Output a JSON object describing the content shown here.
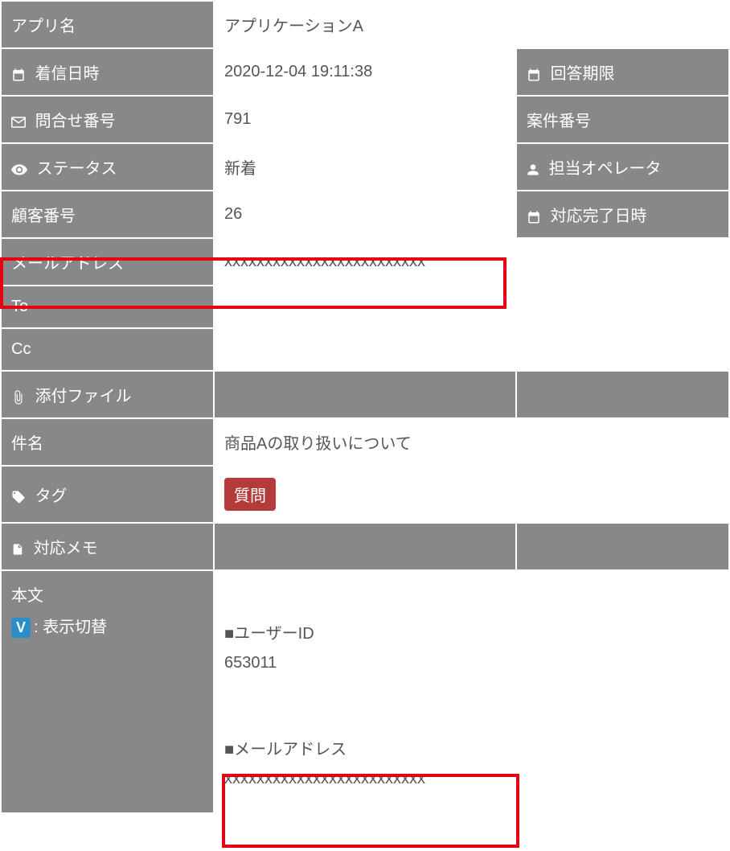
{
  "rows": {
    "app_name": {
      "label": "アプリ名",
      "value": "アプリケーションA"
    },
    "received": {
      "label": "着信日時",
      "value": "2020-12-04 19:11:38",
      "right_label": "回答期限"
    },
    "inquiry_no": {
      "label": "問合せ番号",
      "value": "791",
      "right_label": "案件番号"
    },
    "status": {
      "label": "ステータス",
      "value": "新着",
      "right_label": "担当オペレータ"
    },
    "customer_no": {
      "label": "顧客番号",
      "value": "26",
      "right_label": "対応完了日時"
    },
    "email": {
      "label": "メールアドレス",
      "value": "xxxxxxxxxxxxxxxxxxxxxxxxx"
    },
    "to": {
      "label": "To"
    },
    "cc": {
      "label": "Cc"
    },
    "attachment": {
      "label": "添付ファイル"
    },
    "subject": {
      "label": "件名",
      "value": "商品Aの取り扱いについて"
    },
    "tag": {
      "label": "タグ",
      "badge": "質問"
    },
    "memo": {
      "label": "対応メモ"
    },
    "body": {
      "label": "本文",
      "toggle_badge": "V",
      "toggle_label": ": 表示切替",
      "line1": "■ユーザーID",
      "line2": "653011",
      "line3": "■メールアドレス",
      "line4": "xxxxxxxxxxxxxxxxxxxxxxxxx"
    }
  }
}
